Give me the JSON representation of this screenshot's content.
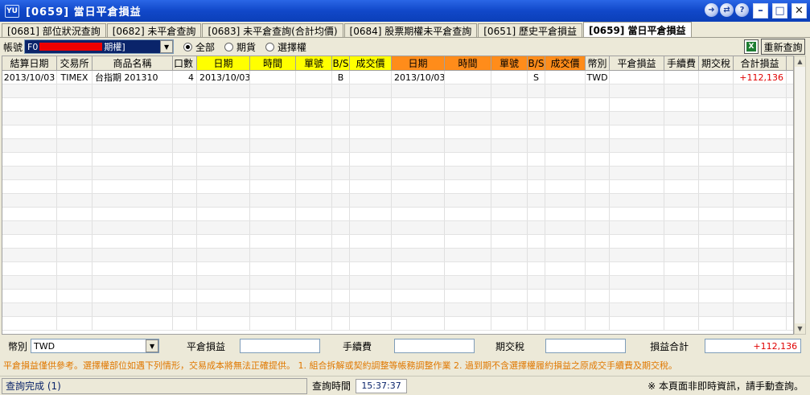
{
  "window": {
    "title": "[0659] 當日平倉損益",
    "app_icon": "YU"
  },
  "tabs": [
    {
      "label": "[0681] 部位狀況查詢",
      "active": false
    },
    {
      "label": "[0682] 未平倉查詢",
      "active": false
    },
    {
      "label": "[0683] 未平倉查詢(合計均價)",
      "active": false
    },
    {
      "label": "[0684] 股票期權未平倉查詢",
      "active": false
    },
    {
      "label": "[0651] 歷史平倉損益",
      "active": false
    },
    {
      "label": "[0659] 當日平倉損益",
      "active": true
    }
  ],
  "filter": {
    "account_label": "帳號",
    "account_prefix": "F0",
    "account_suffix": "期權]",
    "radios": [
      {
        "label": "全部",
        "checked": true
      },
      {
        "label": "期貨",
        "checked": false
      },
      {
        "label": "選擇權",
        "checked": false
      }
    ],
    "refresh_label": "重新查詢"
  },
  "table": {
    "headers": [
      {
        "label": "結算日期",
        "w": 68,
        "style": ""
      },
      {
        "label": "交易所",
        "w": 44,
        "style": ""
      },
      {
        "label": "商品名稱",
        "w": 100,
        "style": ""
      },
      {
        "label": "口數",
        "w": 30,
        "style": "right"
      },
      {
        "label": "日期",
        "w": 66,
        "style": "y"
      },
      {
        "label": "時間",
        "w": 57,
        "style": "y"
      },
      {
        "label": "單號",
        "w": 45,
        "style": "y"
      },
      {
        "label": "B/S",
        "w": 22,
        "style": "y"
      },
      {
        "label": "成交價",
        "w": 52,
        "style": "y"
      },
      {
        "label": "日期",
        "w": 66,
        "style": "o"
      },
      {
        "label": "時間",
        "w": 58,
        "style": "o"
      },
      {
        "label": "單號",
        "w": 45,
        "style": "o"
      },
      {
        "label": "B/S",
        "w": 22,
        "style": "o"
      },
      {
        "label": "成交價",
        "w": 50,
        "style": "o"
      },
      {
        "label": "幣別",
        "w": 30,
        "style": ""
      },
      {
        "label": "平倉損益",
        "w": 68,
        "style": ""
      },
      {
        "label": "手續費",
        "w": 43,
        "style": ""
      },
      {
        "label": "期交稅",
        "w": 43,
        "style": ""
      },
      {
        "label": "合計損益",
        "w": 66,
        "style": ""
      }
    ],
    "rows": [
      [
        "2013/10/03",
        "TIMEX",
        "台指期 201310",
        "4",
        "2013/10/03",
        "",
        "",
        "B",
        "",
        "2013/10/03",
        "",
        "",
        "S",
        "",
        "TWD",
        "",
        "",
        "",
        "+112,136"
      ]
    ],
    "empty_rows": 18
  },
  "summary": {
    "currency_label": "幣別",
    "currency_value": "TWD",
    "close_pl_label": "平倉損益",
    "close_pl_value": "",
    "fee_label": "手續費",
    "fee_value": "",
    "tax_label": "期交稅",
    "tax_value": "",
    "total_label": "損益合計",
    "total_value": "+112,136"
  },
  "notes": "平倉損益僅供參考。選擇權部位如遇下列情形，交易成本將無法正確提供。  1. 組合拆解或契約調整等帳務調整作業   2. 過到期不含選擇權履約損益之原成交手續費及期交稅。",
  "status": {
    "left": "查詢完成 (1)",
    "time_label": "查詢時間",
    "time_value": "15:37:37",
    "right": "※ 本頁面非即時資訊，請手動查詢。"
  },
  "colors": {
    "title_bar": "#1148c9",
    "header_yellow": "#ffff00",
    "header_orange": "#ff8c1a",
    "profit_red": "#e00000",
    "notes_orange": "#e07800"
  }
}
